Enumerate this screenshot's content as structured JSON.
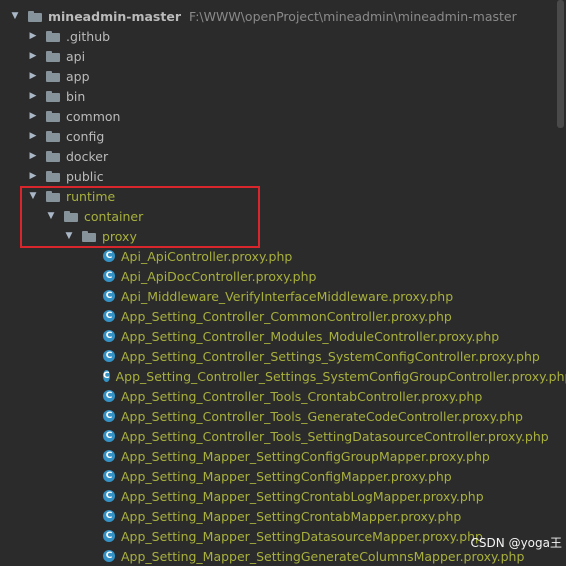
{
  "root": {
    "name": "mineadmin-master",
    "path": "F:\\WWW\\openProject\\mineadmin\\mineadmin-master"
  },
  "folders_top": [
    ".github",
    "api",
    "app",
    "bin",
    "common",
    "config",
    "docker",
    "public"
  ],
  "runtime": {
    "label": "runtime",
    "container": "container",
    "proxy": "proxy"
  },
  "files": [
    "Api_ApiController.proxy.php",
    "Api_ApiDocController.proxy.php",
    "Api_Middleware_VerifyInterfaceMiddleware.proxy.php",
    "App_Setting_Controller_CommonController.proxy.php",
    "App_Setting_Controller_Modules_ModuleController.proxy.php",
    "App_Setting_Controller_Settings_SystemConfigController.proxy.php",
    "App_Setting_Controller_Settings_SystemConfigGroupController.proxy.php",
    "App_Setting_Controller_Tools_CrontabController.proxy.php",
    "App_Setting_Controller_Tools_GenerateCodeController.proxy.php",
    "App_Setting_Controller_Tools_SettingDatasourceController.proxy.php",
    "App_Setting_Mapper_SettingConfigGroupMapper.proxy.php",
    "App_Setting_Mapper_SettingConfigMapper.proxy.php",
    "App_Setting_Mapper_SettingCrontabLogMapper.proxy.php",
    "App_Setting_Mapper_SettingCrontabMapper.proxy.php",
    "App_Setting_Mapper_SettingDatasourceMapper.proxy.php",
    "App_Setting_Mapper_SettingGenerateColumnsMapper.proxy.php"
  ],
  "file_icon_letter": "C",
  "watermark": "CSDN @yoga王",
  "colors": {
    "background": "#2b2b2b",
    "excluded": "#a8b03d",
    "highlight": "#d8262c",
    "icon": "#3592c4"
  }
}
